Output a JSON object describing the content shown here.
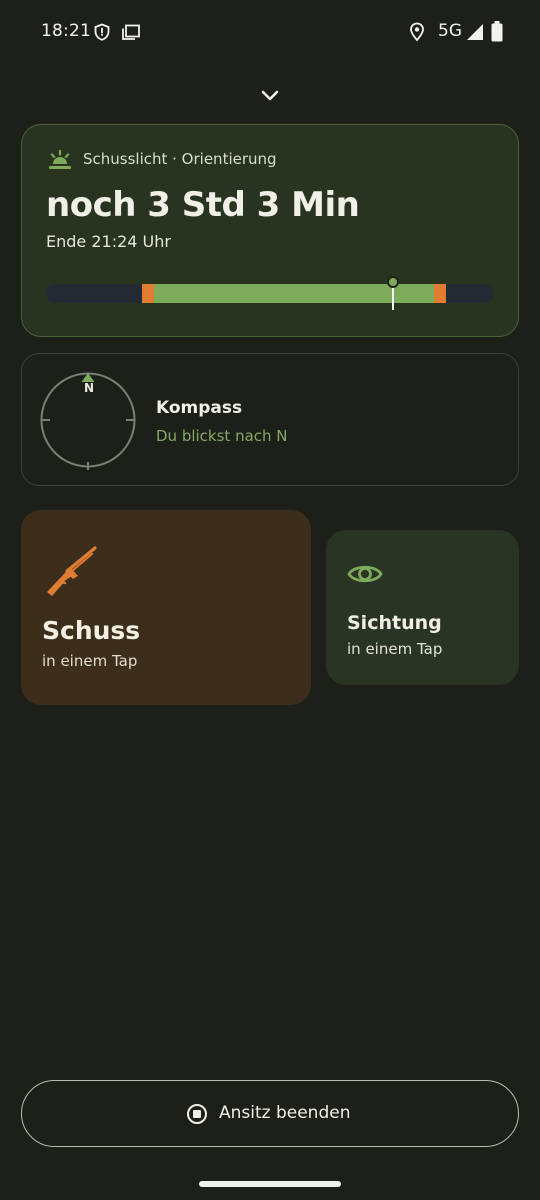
{
  "status_bar": {
    "time": "18:21",
    "network": "5G",
    "icons": [
      "shield-icon",
      "cast-icon",
      "location-icon",
      "signal-icon",
      "battery-icon"
    ]
  },
  "twilight": {
    "icon": "sunrise-icon",
    "subtitle": "Schusslicht · Orientierung",
    "headline": "noch 3 Std 3 Min",
    "end_text": "Ende 21:24 Uhr"
  },
  "compass": {
    "north_label": "N",
    "title": "Kompass",
    "subtitle": "Du blickst nach N"
  },
  "actions": {
    "shot": {
      "icon": "rifle-icon",
      "title": "Schuss",
      "subtitle": "in einem Tap"
    },
    "sighting": {
      "icon": "eye-icon",
      "title": "Sichtung",
      "subtitle": "in einem Tap"
    }
  },
  "end_button": {
    "icon": "stop-icon",
    "label": "Ansitz beenden"
  },
  "colors": {
    "background": "#1d1f19",
    "accent_green": "#7eab5a",
    "accent_orange": "#e07d33",
    "twilight_card": "#28341f",
    "shot_card": "#3c2e1b",
    "sighting_card": "#2a3425"
  }
}
